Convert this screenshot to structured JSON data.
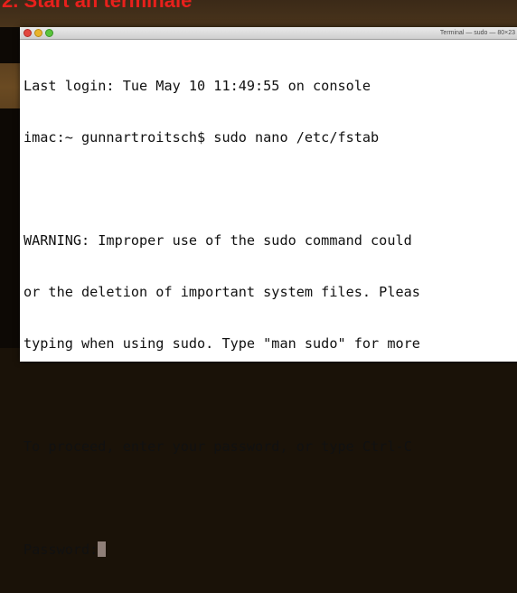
{
  "caption": "2. Start an terminale",
  "window": {
    "title": "Terminal — sudo — 80×23"
  },
  "terminal": {
    "lines": [
      "Last login: Tue May 10 11:49:55 on console",
      "imac:~ gunnartroitsch$ sudo nano /etc/fstab",
      "",
      "WARNING: Improper use of the sudo command could",
      "or the deletion of important system files. Pleas",
      "typing when using sudo. Type \"man sudo\" for more",
      "",
      "To proceed, enter your password, or type Ctrl-C",
      ""
    ],
    "prompt": "Password:"
  },
  "colors": {
    "caption": "#e8201c",
    "close": "#e2463f",
    "minimize": "#e9b42b",
    "zoom": "#5ac43c",
    "cursor": "#8f7f78"
  }
}
